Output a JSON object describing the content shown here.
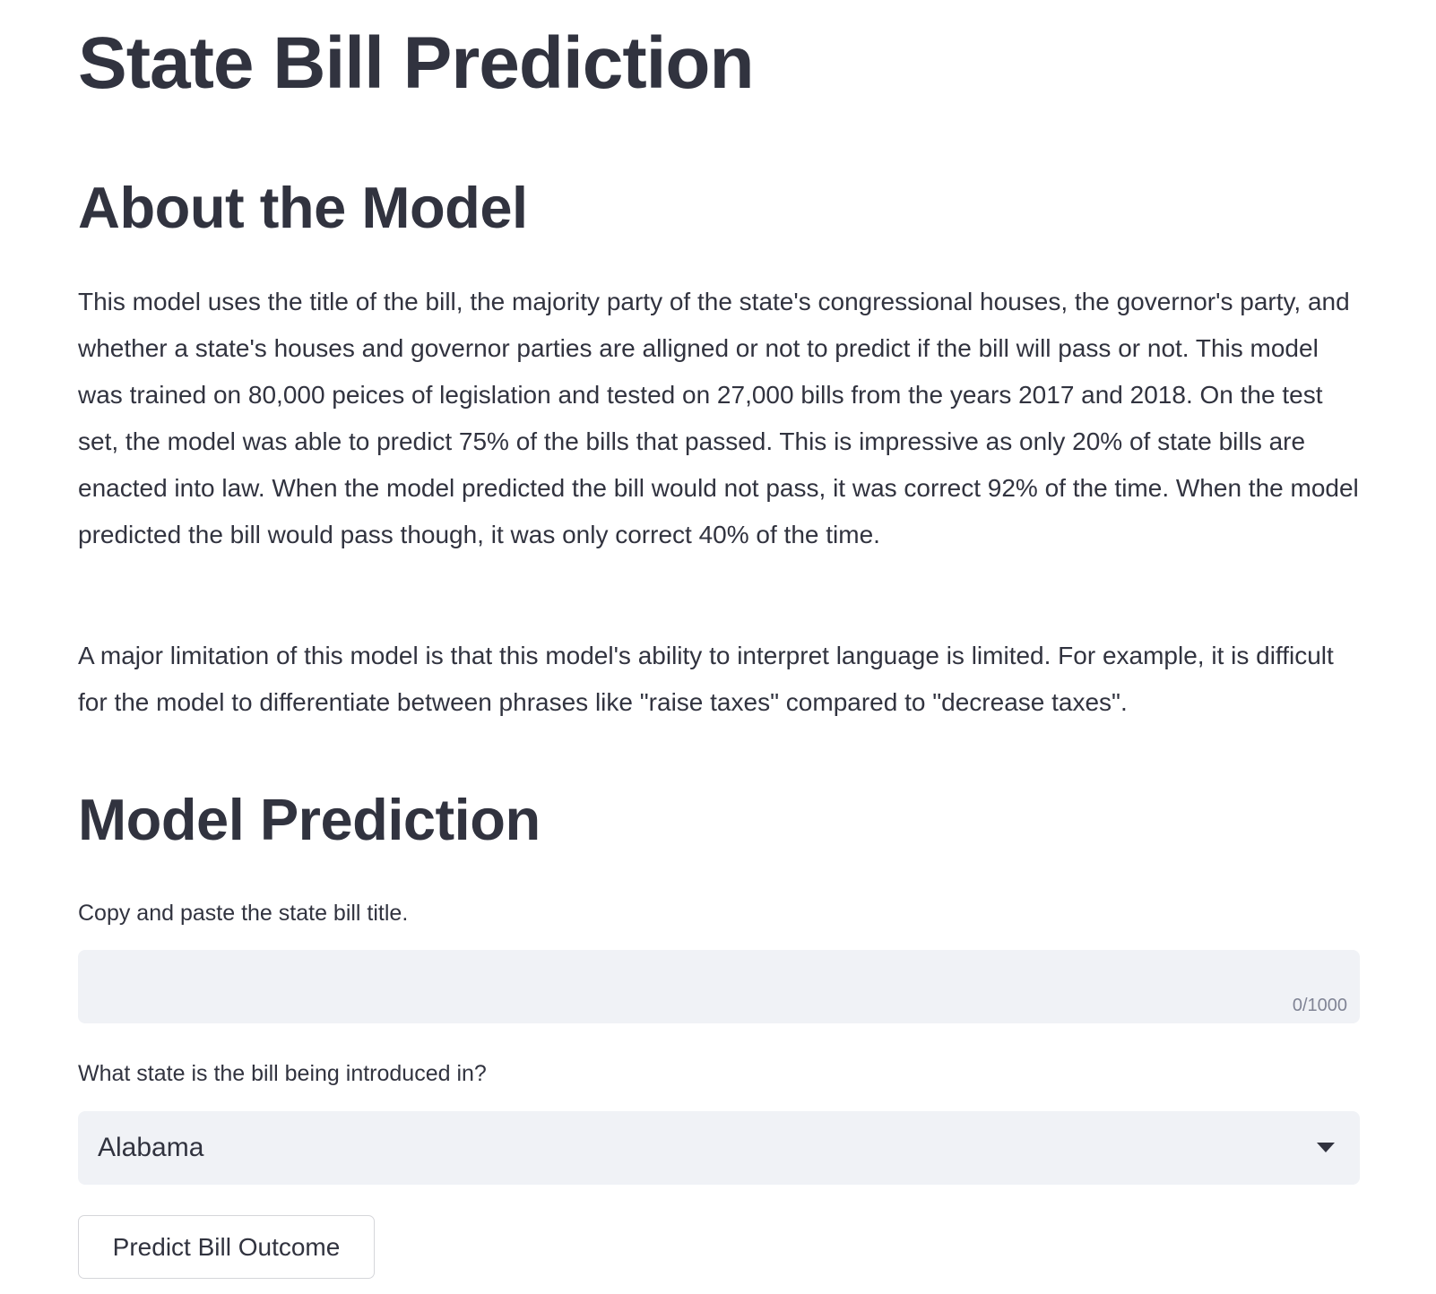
{
  "page": {
    "title": "State Bill Prediction"
  },
  "about": {
    "heading": "About the Model",
    "paragraph_1": "This model uses the title of the bill, the majority party of the state's congressional houses, the governor's party, and whether a state's houses and governor parties are alligned or not to predict if the bill will pass or not. This model was trained on 80,000 peices of legislation and tested on 27,000 bills from the years 2017 and 2018. On the test set, the model was able to predict 75% of the bills that passed. This is impressive as only 20% of state bills are enacted into law. When the model predicted the bill would not pass, it was correct 92% of the time. When the model predicted the bill would pass though, it was only correct 40% of the time.",
    "paragraph_2": "A major limitation of this model is that this model's ability to interpret language is limited. For example, it is difficult for the model to differentiate between phrases like \"raise taxes\" compared to \"decrease taxes\"."
  },
  "prediction": {
    "heading": "Model Prediction",
    "bill_title_label": "Copy and paste the state bill title.",
    "bill_title_value": "",
    "bill_title_counter": "0/1000",
    "state_label": "What state is the bill being introduced in?",
    "state_selected": "Alabama",
    "state_icon": "chevron-down-icon",
    "button_label": "Predict Bill Outcome"
  },
  "colors": {
    "text": "#31333f",
    "input_background": "#f0f2f6",
    "counter_text": "#808495",
    "button_border": "#d5d6da"
  }
}
